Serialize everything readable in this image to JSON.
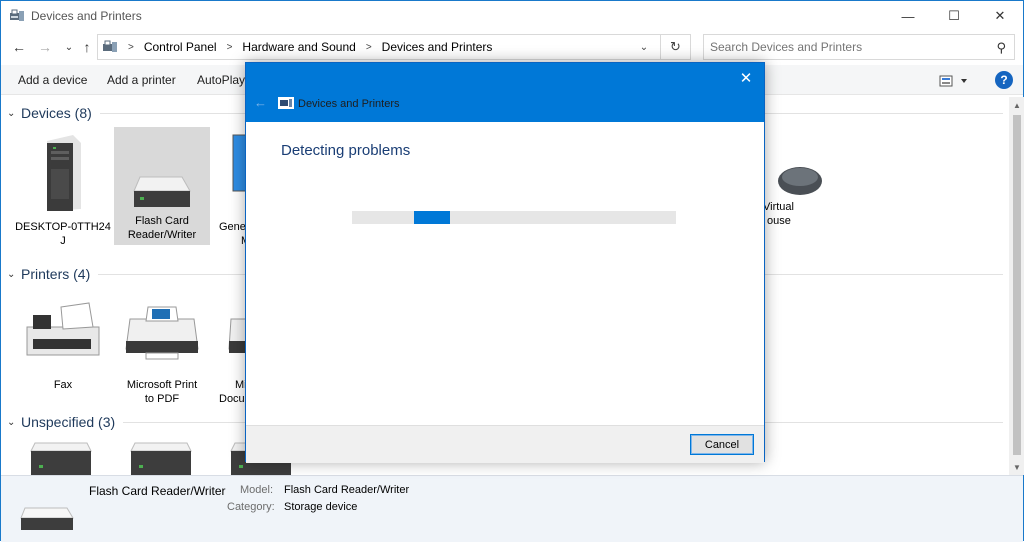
{
  "window": {
    "title": "Devices and Printers"
  },
  "titlebar": {
    "minimize": "—",
    "maximize": "☐",
    "close": "✕"
  },
  "nav": {
    "back": "←",
    "forward": "→",
    "recent": "⌄",
    "up": "↑"
  },
  "breadcrumb": [
    "Control Panel",
    "Hardware and Sound",
    "Devices and Printers"
  ],
  "search": {
    "placeholder": "Search Devices and Printers"
  },
  "commands": [
    "Add a device",
    "Add a printer",
    "AutoPlay"
  ],
  "groups": [
    {
      "title": "Devices (8)",
      "devices": [
        "DESKTOP-0TTH24 J",
        "Flash Card Reader/Writer",
        "Gene M",
        "Virtual ouse"
      ]
    },
    {
      "title": "Printers (4)",
      "devices": [
        "Fax",
        "Microsoft Print to PDF",
        "Mic Docu"
      ]
    },
    {
      "title": "Unspecified (3)",
      "devices": []
    }
  ],
  "devices_group": {
    "title": "Devices (8)",
    "d1": [
      "DESKTOP-0TTH24",
      "J"
    ],
    "d2": [
      "Flash Card",
      "Reader/Writer"
    ],
    "d3": [
      "Gene",
      "M"
    ],
    "d4": [
      "Virtual",
      "ouse"
    ]
  },
  "printers_group": {
    "title": "Printers (4)",
    "p1": [
      "Fax"
    ],
    "p2": [
      "Microsoft Print",
      "to PDF"
    ],
    "p3": [
      "Mic",
      "Docu"
    ]
  },
  "unspecified_group": {
    "title": "Unspecified (3)"
  },
  "details": {
    "name": "Flash Card Reader/Writer",
    "model_label": "Model:",
    "model_value": "Flash Card Reader/Writer",
    "category_label": "Category:",
    "category_value": "Storage device"
  },
  "dialog": {
    "title": "Devices and Printers",
    "heading": "Detecting problems",
    "close": "✕",
    "back": "←",
    "cancel_label": "Cancel",
    "progress": 0.19
  },
  "colors": {
    "accent": "#0078d7",
    "heading": "#1a3e75",
    "group_title": "#1e395b"
  }
}
